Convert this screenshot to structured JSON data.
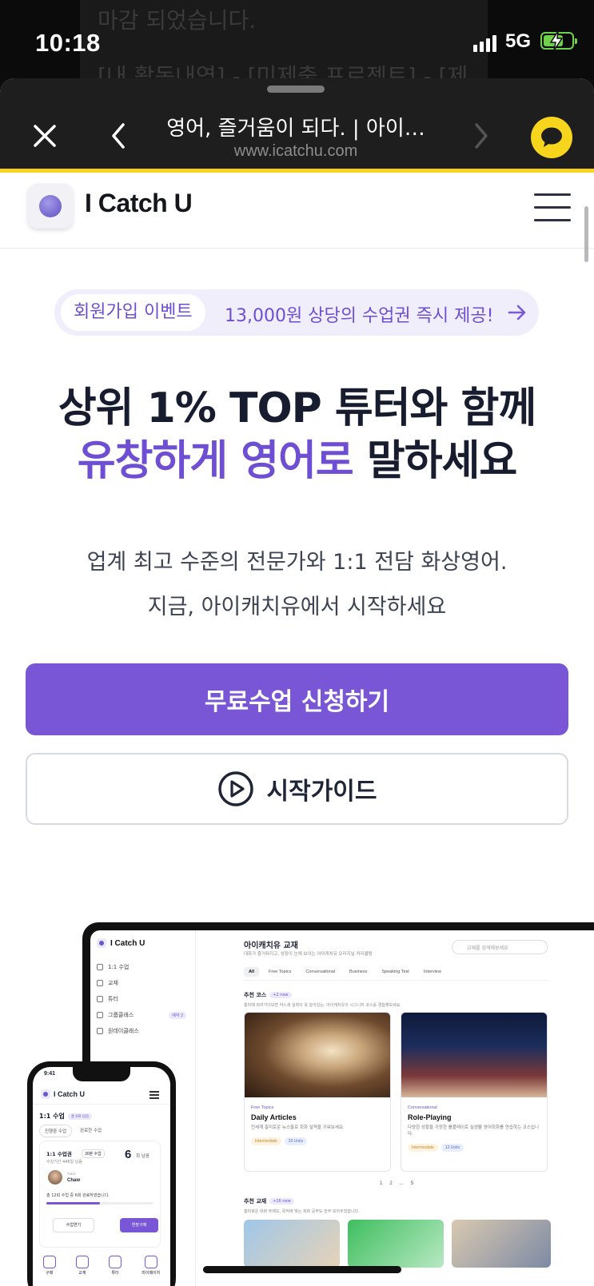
{
  "status_bar": {
    "time": "10:18",
    "network": "5G",
    "background_line1": "마감 되었습니다.",
    "background_line2": "[내 활동내역] - [미제출 프로젝트] - [제"
  },
  "sheet_header": {
    "title": "영어, 즐거움이 되다. | 아이…",
    "url": "www.icatchu.com",
    "accent": "#f7d51d"
  },
  "site": {
    "brand": "I Catch U"
  },
  "event": {
    "tag": "회원가입 이벤트",
    "text": "13,000원 상당의 수업권 즉시 제공!"
  },
  "hero": {
    "line1": "상위 1% TOP 튜터와 함께",
    "line2_accent": "유창하게 영어로",
    "line2_rest": " 말하세요",
    "sub1": "업계 최고 수준의 전문가와 1:1 전담 화상영어.",
    "sub2": "지금, 아이캐치유에서 시작하세요",
    "accent_color": "#6e4fd3"
  },
  "buttons": {
    "cta": "무료수업 신청하기",
    "guide": "시작가이드",
    "cta_color": "#7856d6"
  },
  "laptop_mock": {
    "brand": "I Catch U",
    "sidebar": [
      {
        "label": "1:1 수업"
      },
      {
        "label": "교재"
      },
      {
        "label": "튜터"
      },
      {
        "label": "그룹클래스",
        "badge": "예약 2"
      },
      {
        "label": "원데이클래스"
      }
    ],
    "title": "아이캐치유 교재",
    "subtitle": "대화가 즐거워지고, 성장이 눈에 보이는 아이캐치유 오리지널 커리큘럼",
    "search_placeholder": "교재를 검색해보세요",
    "tabs": [
      "All",
      "Free Topics",
      "Conversational",
      "Business",
      "Speaking Test",
      "Interview"
    ],
    "section1": {
      "title": "추천 코스",
      "badge": "+2 new",
      "desc": "흥미에 따라가다보면 어느새 실력이 쑥 늘어있는, 아이캐치유의 시그니처 코스를 경험해보세요"
    },
    "cards": [
      {
        "category": "Free Topics",
        "name": "Daily Articles",
        "desc": "전세계 흥미로운 뉴스들로 회화 실력을 키워보세요.",
        "level": "Intermediate",
        "units": "20 Units"
      },
      {
        "category": "Conversational",
        "name": "Role-Playing",
        "desc": "다양한 상황을 가정한 롤플레이로 실생활 영어회화를 연습하는 코스입니다.",
        "level": "Intermediate",
        "units": "12 Units"
      }
    ],
    "pager": [
      "1",
      "2",
      "...",
      "5"
    ],
    "section2": {
      "title": "추천 교재",
      "badge": "+16 new",
      "desc": "흥미로운 대화 주제도, 목적에 맞는 회화 공부도 전부 모아두었습니다."
    }
  },
  "phone_mock": {
    "time": "9:41",
    "brand": "I Catch U",
    "heading": "1:1 수업",
    "heading_badge": "총 6회 남음",
    "tabs": [
      "진행중 수업",
      "완료한 수업"
    ],
    "pass_name": "1:1 수업권",
    "pass_len": "30분 수업",
    "pass_period": "수강기간 446일 남음",
    "remaining_num": "6",
    "remaining_unit": "회 남음",
    "tutor_label": "Tutor",
    "tutor_name": "Chaw",
    "progress_text": "총 12회 수업 중 6회 완료하였습니다.",
    "progress": 0.5,
    "btn_extend": "수업연기",
    "btn_buy": "연장구매",
    "nav": [
      "구매",
      "교재",
      "튜터",
      "마이페이지"
    ]
  }
}
